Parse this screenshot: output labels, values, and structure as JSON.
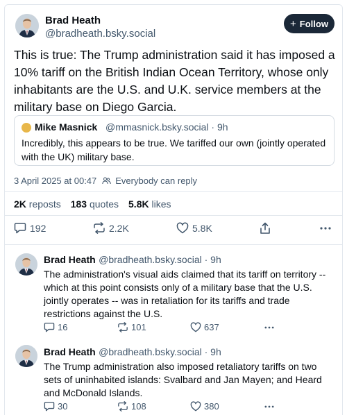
{
  "post": {
    "author_name": "Brad Heath",
    "author_handle": "@bradheath.bsky.social",
    "follow_label": "Follow",
    "text": "This is true: The Trump administration said it has imposed a 10% tariff on the British Indian Ocean Territory, whose only inhabitants are the U.S. and U.K. service members at the military base on Diego Garcia.",
    "quote": {
      "author_name": "Mike Masnick",
      "author_handle": "@mmasnick.bsky.social · 9h",
      "text": "Incredibly, this appears to be true. We tariffed our own (jointly operated with the UK) military base."
    },
    "timestamp": "3 April 2025 at 00:47",
    "reply_setting": "Everybody can reply",
    "stats": {
      "reposts_count": "2K",
      "reposts_label": "reposts",
      "quotes_count": "183",
      "quotes_label": "quotes",
      "likes_count": "5.8K",
      "likes_label": "likes"
    },
    "actions": {
      "replies": "192",
      "reposts": "2.2K",
      "likes": "5.8K"
    }
  },
  "replies": [
    {
      "author_name": "Brad Heath",
      "author_handle": "@bradheath.bsky.social · 9h",
      "text": "The administration's visual aids claimed that its tariff on territory -- which at this point consists only of a military base that the U.S. jointly operates -- was in retaliation for its tariffs and trade restrictions against the U.S.",
      "replies": "16",
      "reposts": "101",
      "likes": "637"
    },
    {
      "author_name": "Brad Heath",
      "author_handle": "@bradheath.bsky.social · 9h",
      "text": "The Trump administration also imposed retaliatory tariffs on two sets of uninhabited islands: Svalbard and Jan Mayen; and Heard and McDonald Islands.",
      "replies": "30",
      "reposts": "108",
      "likes": "380"
    }
  ],
  "colors": {
    "text": "#0b0f14",
    "muted": "#42576c",
    "follow_bg": "#1b2838",
    "border": "#e3e8ee"
  },
  "icons": [
    "plus-icon",
    "people-icon",
    "reply-icon",
    "repost-icon",
    "like-icon",
    "share-icon",
    "more-icon"
  ]
}
